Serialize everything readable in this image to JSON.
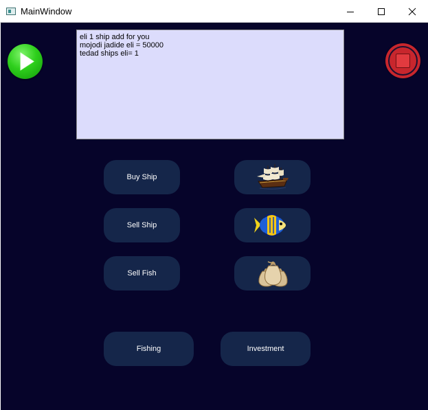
{
  "window": {
    "title": "MainWindow",
    "minimize_glyph": "—",
    "maximize_glyph": "☐",
    "close_glyph": "✕"
  },
  "log": {
    "text": "eli 1 ship add for you\nmojodi jadide eli = 50000\ntedad ships eli= 1"
  },
  "buttons": {
    "buy_ship": "Buy Ship",
    "sell_ship": "Sell Ship",
    "sell_fish": "Sell Fish",
    "fishing": "Fishing",
    "investment": "Investment"
  },
  "icons": {
    "play": "play-icon",
    "stop": "stop-icon",
    "ship": "ship-icon",
    "fish": "fish-icon",
    "money": "money-bags-icon"
  },
  "colors": {
    "background": "#06042a",
    "button": "#15264a",
    "log_bg": "#dcdcfc"
  }
}
